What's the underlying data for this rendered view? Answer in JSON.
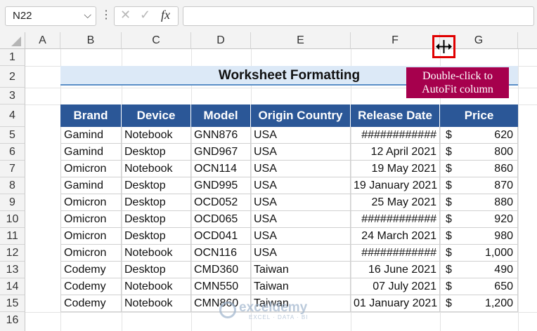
{
  "formula_bar": {
    "name_box": "N22",
    "name_box_chevron": "⌵",
    "options_dots": "⋮",
    "cancel_icon": "✕",
    "enter_icon": "✓",
    "fx_label": "fx",
    "formula_value": ""
  },
  "columns": [
    "A",
    "B",
    "C",
    "D",
    "E",
    "F",
    "G"
  ],
  "rows": [
    "1",
    "2",
    "3",
    "4",
    "5",
    "6",
    "7",
    "8",
    "9",
    "10",
    "11",
    "12",
    "13",
    "14",
    "15",
    "16"
  ],
  "sheet": {
    "title": "Worksheet Formatting",
    "note": "Double-click to AutoFit column",
    "cursor_icon": "column-resize-cursor-icon",
    "headers": [
      "Brand",
      "Device",
      "Model",
      "Origin Country",
      "Release Date",
      "Price"
    ],
    "records": [
      {
        "brand": "Gamind",
        "device": "Notebook",
        "model": "GNN876",
        "country": "USA",
        "date": "############",
        "currency": "$",
        "price": "620"
      },
      {
        "brand": "Gamind",
        "device": "Desktop",
        "model": "GND967",
        "country": "USA",
        "date": "12 April 2021",
        "currency": "$",
        "price": "800"
      },
      {
        "brand": "Omicron",
        "device": "Notebook",
        "model": "OCN114",
        "country": "USA",
        "date": "19 May 2021",
        "currency": "$",
        "price": "860"
      },
      {
        "brand": "Gamind",
        "device": "Desktop",
        "model": "GND995",
        "country": "USA",
        "date": "19 January 2021",
        "currency": "$",
        "price": "870"
      },
      {
        "brand": "Omicron",
        "device": "Desktop",
        "model": "OCD052",
        "country": "USA",
        "date": "25 May 2021",
        "currency": "$",
        "price": "880"
      },
      {
        "brand": "Omicron",
        "device": "Desktop",
        "model": "OCD065",
        "country": "USA",
        "date": "############",
        "currency": "$",
        "price": "920"
      },
      {
        "brand": "Omicron",
        "device": "Desktop",
        "model": "OCD041",
        "country": "USA",
        "date": "24 March 2021",
        "currency": "$",
        "price": "980"
      },
      {
        "brand": "Omicron",
        "device": "Notebook",
        "model": "OCN116",
        "country": "USA",
        "date": "############",
        "currency": "$",
        "price": "1,000"
      },
      {
        "brand": "Codemy",
        "device": "Desktop",
        "model": "CMD360",
        "country": "Taiwan",
        "date": "16 June 2021",
        "currency": "$",
        "price": "490"
      },
      {
        "brand": "Codemy",
        "device": "Notebook",
        "model": "CMN550",
        "country": "Taiwan",
        "date": "07 July 2021",
        "currency": "$",
        "price": "650"
      },
      {
        "brand": "Codemy",
        "device": "Notebook",
        "model": "CMN860",
        "country": "Taiwan",
        "date": "01 January 2021",
        "currency": "$",
        "price": "1,200"
      }
    ]
  },
  "watermark": {
    "name": "exceldemy",
    "tagline": "EXCEL · DATA · BI"
  },
  "colors": {
    "header_fill": "#2b5797",
    "title_fill": "#dce9f7",
    "note_fill": "#a6004d",
    "highlight_border": "#e00000"
  }
}
